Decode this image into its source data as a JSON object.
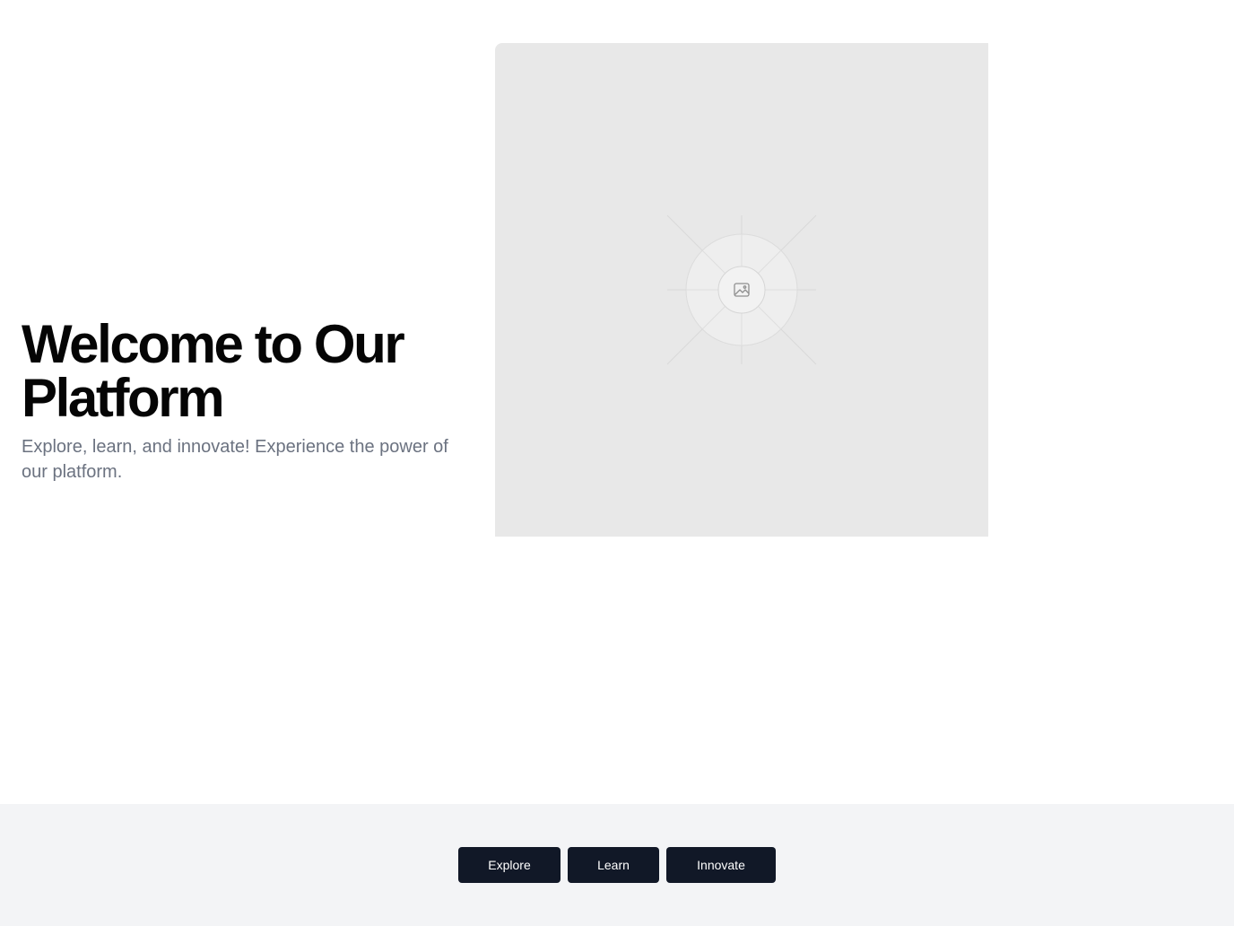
{
  "hero": {
    "title": "Welcome to Our Platform",
    "subtitle": "Explore, learn, and innovate! Experience the power of our platform.",
    "image_icon": "image-placeholder-icon"
  },
  "footer": {
    "buttons": [
      {
        "label": "Explore"
      },
      {
        "label": "Learn"
      },
      {
        "label": "Innovate"
      }
    ]
  },
  "colors": {
    "button_bg": "#111827",
    "footer_bg": "#f3f4f6",
    "placeholder_bg": "#e8e8e8",
    "subtitle_text": "#6b7280"
  }
}
